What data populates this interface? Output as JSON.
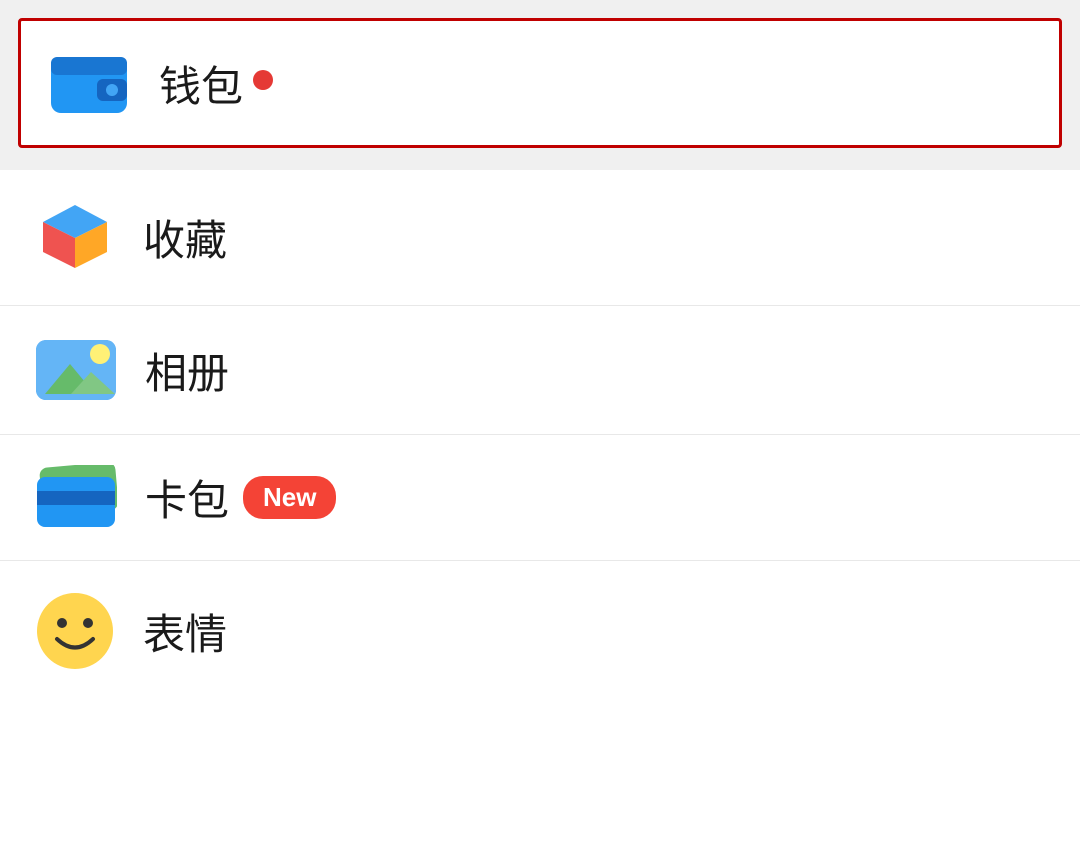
{
  "page": {
    "background_color": "#f0f0f0"
  },
  "highlighted_item": {
    "label": "钱包",
    "has_notification": true,
    "icon_type": "wallet"
  },
  "list_items": [
    {
      "id": "favorites",
      "label": "收藏",
      "icon_type": "collection",
      "badge": null
    },
    {
      "id": "album",
      "label": "相册",
      "icon_type": "album",
      "badge": null
    },
    {
      "id": "cardpack",
      "label": "卡包",
      "icon_type": "cardpack",
      "badge": "New"
    },
    {
      "id": "emoji",
      "label": "表情",
      "icon_type": "emoji",
      "badge": null
    }
  ],
  "badge_colors": {
    "new": "#f44336",
    "dot": "#e53935"
  }
}
